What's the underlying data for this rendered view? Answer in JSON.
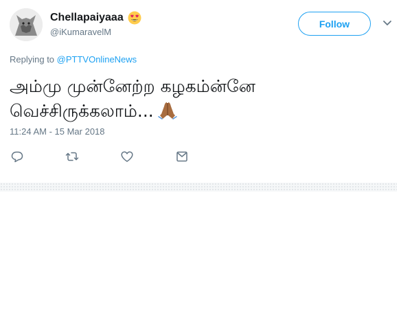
{
  "user": {
    "display_name": "Chellapaiyaaa",
    "handle": "@iKumaravelM",
    "name_emoji": "heart-eyes-emoji"
  },
  "header": {
    "follow_label": "Follow",
    "menu_icon": "chevron-down-icon"
  },
  "reply": {
    "prefix": "Replying to",
    "target": "@PTTVOnlineNews"
  },
  "tweet": {
    "text_line1": "அம்மு முன்னேற்ற கழகம்ன்னே",
    "text_line2": "வெச்சிருக்கலாம்...",
    "trailing_emoji": "folded-hands-emoji",
    "timestamp": "11:24 AM - 15 Mar 2018"
  },
  "actions": [
    {
      "name": "reply",
      "icon": "reply-icon"
    },
    {
      "name": "retweet",
      "icon": "retweet-icon"
    },
    {
      "name": "like",
      "icon": "heart-icon"
    },
    {
      "name": "direct-message",
      "icon": "envelope-icon"
    }
  ],
  "colors": {
    "accent": "#1da1f2",
    "secondary_text": "#657786",
    "primary_text": "#14171a",
    "icon": "#657786"
  }
}
